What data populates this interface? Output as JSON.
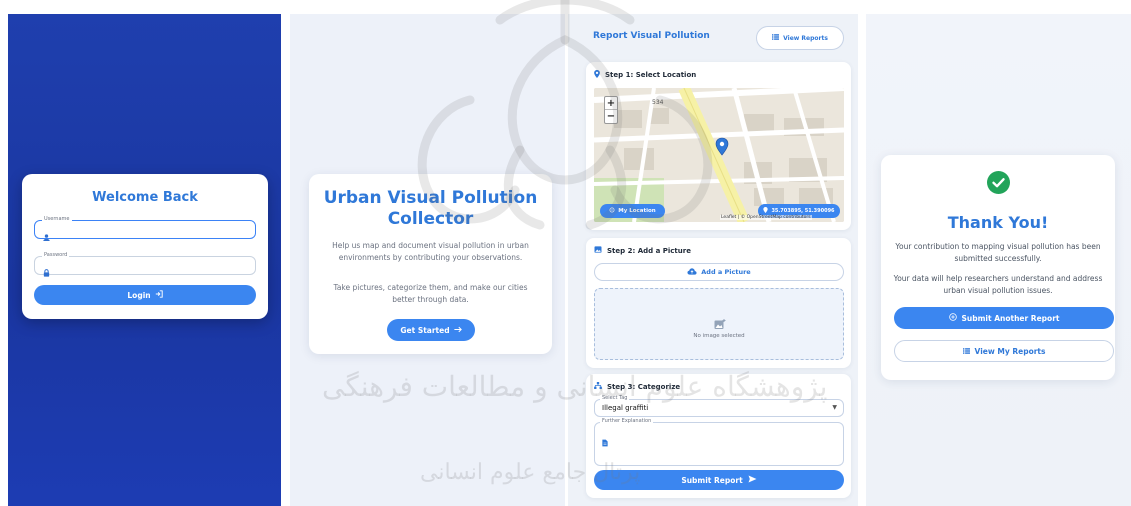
{
  "login": {
    "title": "Welcome Back",
    "username_label": "Username",
    "password_label": "Password",
    "button_label": "Login"
  },
  "intro": {
    "title_line1": "Urban Visual Pollution",
    "title_line2": "Collector",
    "description": "Help us map and document visual pollution in urban environments by contributing your observations.",
    "description2": "Take pictures, categorize them, and make our cities better through data.",
    "start_label": "Get Started"
  },
  "report": {
    "title": "Report Visual Pollution",
    "view_reports_label": "View Reports",
    "step1_label": "Step 1: Select Location",
    "zoom_in": "+",
    "zoom_out": "−",
    "my_location_label": "My Location",
    "coordinates": "35.703895, 51.390096",
    "attribution": "Leaflet | © OpenStreetMap contributors",
    "map_street_number": "534",
    "step2_label": "Step 2: Add a Picture",
    "add_picture_label": "Add a Picture",
    "no_image_label": "No image selected",
    "step3_label": "Step 3: Categorize",
    "select_tag_label": "Select Tag",
    "selected_tag": "Illegal graffiti",
    "explanation_label": "Further Explanation",
    "submit_label": "Submit Report"
  },
  "thanks": {
    "title": "Thank You!",
    "message1": "Your contribution to mapping visual pollution has been submitted successfully.",
    "message2": "Your data will help researchers understand and address urban visual pollution issues.",
    "another_label": "Submit Another Report",
    "my_reports_label": "View My Reports"
  },
  "watermark": {
    "line1": "پژوهشگاه علوم انسانی و مطالعات فرهنگی",
    "line2": "پرتال جامع علوم انسانی"
  },
  "colors": {
    "primary": "#3b86f0",
    "title_blue": "#2f78d8",
    "login_bg": "#1f3fae",
    "success": "#22a45a"
  },
  "icons": [
    "user-icon",
    "lock-icon",
    "login-icon",
    "arrow-right-icon",
    "list-icon",
    "pin-icon",
    "image-icon",
    "upload-icon",
    "sitemap-icon",
    "send-icon",
    "check-circle-icon",
    "plus-circle-icon",
    "crosshair-icon",
    "doc-icon",
    "caret-down-icon"
  ]
}
